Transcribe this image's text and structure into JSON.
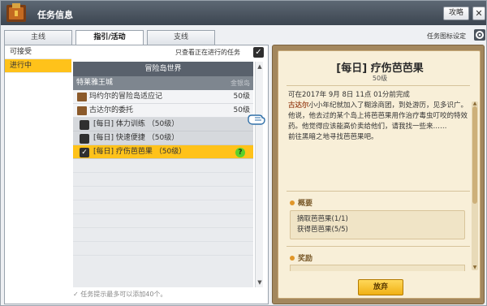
{
  "window": {
    "title": "任务信息",
    "guide_label": "攻略",
    "close_label": "✕"
  },
  "tabs": [
    {
      "label": "主线"
    },
    {
      "label": "指引/活动"
    },
    {
      "label": "支线"
    }
  ],
  "settings_label": "任务图标设定",
  "sidebar": {
    "items": [
      {
        "label": "可接受"
      },
      {
        "label": "进行中"
      }
    ]
  },
  "filter": {
    "only_in_progress_label": "只查看正在进行的任务",
    "checked": true
  },
  "list": {
    "header": "冒险岛世界",
    "region": {
      "name": "特莱雅王城",
      "level_hint": "金银岛"
    },
    "quests": [
      {
        "name": "玛约尔的冒险岛适应记",
        "level": "50级"
      },
      {
        "name": "古达尔的委托",
        "level": "50级"
      }
    ],
    "subquests": [
      {
        "name": "[每日] 体力训练 （50级）"
      },
      {
        "name": "[每日] 快速便捷 （50级）"
      },
      {
        "name": "[每日] 疗伤芭芭果 （50级）",
        "selected": true,
        "mark": "?"
      }
    ],
    "footer_note": "任务提示最多可以添加40个。"
  },
  "detail": {
    "title": "[每日] 疗伤芭芭果",
    "level": "50级",
    "complete_time": "可在2017年 9月 8日 11点 01分前完成",
    "npc": "古达尔",
    "text1": "小小年纪就加入了糊涂商团，到处游历，见多识广。",
    "text2": "他说，他去过的某个岛上将芭芭果用作治疗毒虫叮咬的特效药。他觉得应该能高价卖给他们，请我找一些来……",
    "text3": "前往黑暗之地寻找芭芭果吧。",
    "summary_label": "概要",
    "summary_items": [
      "摘取芭芭果(1/1)",
      "获得芭芭果(5/5)"
    ],
    "reward_label": "奖励",
    "abandon_label": "放弃"
  }
}
